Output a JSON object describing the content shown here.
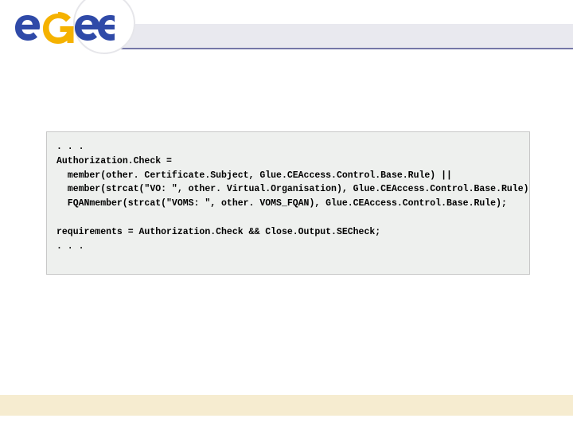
{
  "brand": {
    "name": "egee"
  },
  "code": {
    "l1": ". . .",
    "l2": "Authorization.Check =",
    "l3": "member(other. Certificate.Subject, Glue.CEAccess.Control.Base.Rule) ||",
    "l4": "member(strcat(\"VO: \", other. Virtual.Organisation), Glue.CEAccess.Control.Base.Rule) ||",
    "l5": "FQANmember(strcat(\"VOMS: \", other. VOMS_FQAN), Glue.CEAccess.Control.Base.Rule);",
    "l6": "requirements = Authorization.Check && Close.Output.SECheck;",
    "l7": ". . ."
  },
  "colors": {
    "brand_blue": "#2f4aa8",
    "brand_yellow": "#f5b200",
    "header_band": "#e9e9ef",
    "header_rule": "#7577a7",
    "code_bg": "#eef0ee",
    "footer_bg": "#f6ecd0"
  }
}
